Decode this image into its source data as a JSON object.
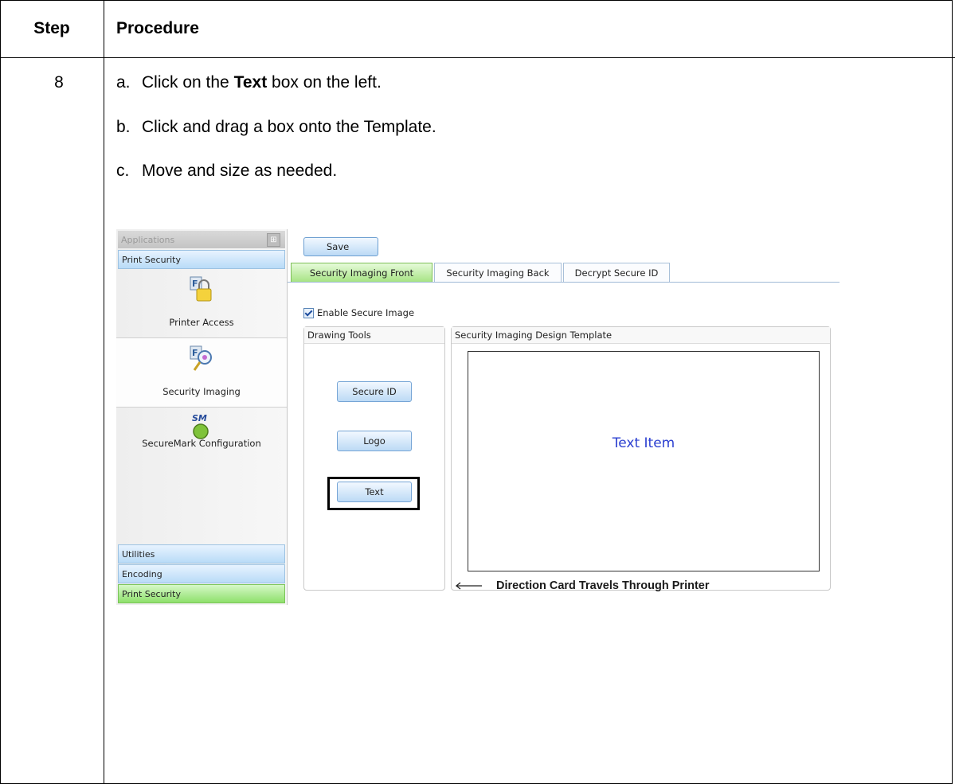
{
  "table": {
    "header_step": "Step",
    "header_procedure": "Procedure",
    "step_number": "8",
    "instructions": [
      {
        "marker": "a.",
        "before": "Click on the ",
        "bold": "Text",
        "after": " box on the left."
      },
      {
        "marker": "b.",
        "before": "Click and drag a box onto the Template.",
        "bold": "",
        "after": ""
      },
      {
        "marker": "c.",
        "before": "Move and size as needed.",
        "bold": "",
        "after": ""
      }
    ]
  },
  "screenshot": {
    "sidebar": {
      "header": "Applications",
      "top_group": "Print Security",
      "items": [
        {
          "label": "Printer Access",
          "icon": "printer-access-lock-icon"
        },
        {
          "label": "Security Imaging",
          "icon": "security-imaging-icon"
        },
        {
          "label": "SecureMark Configuration",
          "icon": "securemark-icon",
          "badge": "SM"
        }
      ],
      "bottom_groups": [
        "Utilities",
        "Encoding",
        "Print Security"
      ]
    },
    "toolbar": {
      "save_label": "Save"
    },
    "tabs": [
      "Security Imaging Front",
      "Security Imaging Back",
      "Decrypt Secure ID"
    ],
    "enable_secure_image": "Enable Secure Image",
    "drawing_tools": {
      "title": "Drawing Tools",
      "buttons": [
        "Secure ID",
        "Logo",
        "Text"
      ]
    },
    "design_template": {
      "title": "Security Imaging Design Template",
      "text_item": "Text Item"
    },
    "direction_note": "Direction Card Travels Through Printer",
    "colors": {
      "active_tab": "#a7e485",
      "button": "#bcdaf5",
      "text_item": "#2b3fd0"
    }
  }
}
